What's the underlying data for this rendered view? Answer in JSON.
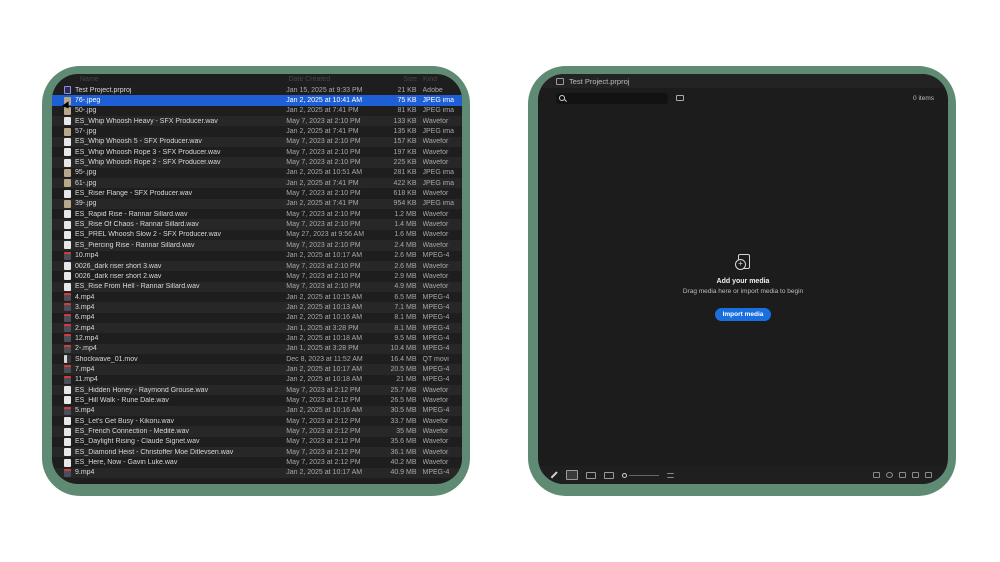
{
  "finder": {
    "header": {
      "name": "Name",
      "date": "Date Created",
      "size": "Size",
      "kind": "Kind"
    },
    "files": [
      {
        "name": "Test Project.prproj",
        "date": "Jan 15, 2025 at 9:33 PM",
        "size": "21 KB",
        "kind": "Adobe",
        "type": "proj"
      },
      {
        "name": "76-.jpeg",
        "date": "Jan 2, 2025 at 10:41 AM",
        "size": "75 KB",
        "kind": "JPEG ima",
        "type": "img",
        "selected": true
      },
      {
        "name": "50-.jpg",
        "date": "Jan 2, 2025 at 7:41 PM",
        "size": "81 KB",
        "kind": "JPEG ima",
        "type": "img"
      },
      {
        "name": "ES_Whip Whoosh Heavy - SFX Producer.wav",
        "date": "May 7, 2023 at 2:10 PM",
        "size": "133 KB",
        "kind": "Wavefor",
        "type": "wav"
      },
      {
        "name": "57-.jpg",
        "date": "Jan 2, 2025 at 7:41 PM",
        "size": "135 KB",
        "kind": "JPEG ima",
        "type": "img"
      },
      {
        "name": "ES_Whip Whoosh 5 - SFX Producer.wav",
        "date": "May 7, 2023 at 2:10 PM",
        "size": "157 KB",
        "kind": "Wavefor",
        "type": "wav"
      },
      {
        "name": "ES_Whip Whoosh Rope 3 - SFX Producer.wav",
        "date": "May 7, 2023 at 2:10 PM",
        "size": "197 KB",
        "kind": "Wavefor",
        "type": "wav"
      },
      {
        "name": "ES_Whip Whoosh Rope 2 - SFX Producer.wav",
        "date": "May 7, 2023 at 2:10 PM",
        "size": "225 KB",
        "kind": "Wavefor",
        "type": "wav"
      },
      {
        "name": "95-.jpg",
        "date": "Jan 2, 2025 at 10:51 AM",
        "size": "281 KB",
        "kind": "JPEG ima",
        "type": "img"
      },
      {
        "name": "61-.jpg",
        "date": "Jan 2, 2025 at 7:41 PM",
        "size": "422 KB",
        "kind": "JPEG ima",
        "type": "img"
      },
      {
        "name": "ES_Riser Flange - SFX Producer.wav",
        "date": "May 7, 2023 at 2:10 PM",
        "size": "618 KB",
        "kind": "Wavefor",
        "type": "wav"
      },
      {
        "name": "39-.jpg",
        "date": "Jan 2, 2025 at 7:41 PM",
        "size": "954 KB",
        "kind": "JPEG ima",
        "type": "img"
      },
      {
        "name": "ES_Rapid Rise - Rannar Sillard.wav",
        "date": "May 7, 2023 at 2:10 PM",
        "size": "1.2 MB",
        "kind": "Wavefor",
        "type": "wav"
      },
      {
        "name": "ES_Rise Of Chaos - Rannar Sillard.wav",
        "date": "May 7, 2023 at 2:10 PM",
        "size": "1.4 MB",
        "kind": "Wavefor",
        "type": "wav"
      },
      {
        "name": "ES_PREL Whoosh Slow 2 - SFX Producer.wav",
        "date": "May 27, 2023 at 9:56 AM",
        "size": "1.6 MB",
        "kind": "Wavefor",
        "type": "wav"
      },
      {
        "name": "ES_Piercing Rise - Rannar Sillard.wav",
        "date": "May 7, 2023 at 2:10 PM",
        "size": "2.4 MB",
        "kind": "Wavefor",
        "type": "wav"
      },
      {
        "name": "10.mp4",
        "date": "Jan 2, 2025 at 10:17 AM",
        "size": "2.6 MB",
        "kind": "MPEG-4",
        "type": "vid"
      },
      {
        "name": "0026_dark riser short 3.wav",
        "date": "May 7, 2023 at 2:10 PM",
        "size": "2.6 MB",
        "kind": "Wavefor",
        "type": "wav"
      },
      {
        "name": "0026_dark riser short 2.wav",
        "date": "May 7, 2023 at 2:10 PM",
        "size": "2.9 MB",
        "kind": "Wavefor",
        "type": "wav"
      },
      {
        "name": "ES_Rise From Hell - Rannar Sillard.wav",
        "date": "May 7, 2023 at 2:10 PM",
        "size": "4.9 MB",
        "kind": "Wavefor",
        "type": "wav"
      },
      {
        "name": "4.mp4",
        "date": "Jan 2, 2025 at 10:15 AM",
        "size": "6.5 MB",
        "kind": "MPEG-4",
        "type": "vid"
      },
      {
        "name": "3.mp4",
        "date": "Jan 2, 2025 at 10:13 AM",
        "size": "7.1 MB",
        "kind": "MPEG-4",
        "type": "vid"
      },
      {
        "name": "6.mp4",
        "date": "Jan 2, 2025 at 10:16 AM",
        "size": "8.1 MB",
        "kind": "MPEG-4",
        "type": "vid"
      },
      {
        "name": "2.mp4",
        "date": "Jan 1, 2025 at 3:28 PM",
        "size": "8.1 MB",
        "kind": "MPEG-4",
        "type": "vid"
      },
      {
        "name": "12.mp4",
        "date": "Jan 2, 2025 at 10:18 AM",
        "size": "9.5 MB",
        "kind": "MPEG-4",
        "type": "vid"
      },
      {
        "name": "2-.mp4",
        "date": "Jan 1, 2025 at 3:28 PM",
        "size": "10.4 MB",
        "kind": "MPEG-4",
        "type": "vid"
      },
      {
        "name": "Shockwave_01.mov",
        "date": "Dec 8, 2023 at 11:52 AM",
        "size": "16.4 MB",
        "kind": "QT movi",
        "type": "qt"
      },
      {
        "name": "7.mp4",
        "date": "Jan 2, 2025 at 10:17 AM",
        "size": "20.5 MB",
        "kind": "MPEG-4",
        "type": "vid"
      },
      {
        "name": "11.mp4",
        "date": "Jan 2, 2025 at 10:18 AM",
        "size": "21 MB",
        "kind": "MPEG-4",
        "type": "vid"
      },
      {
        "name": "ES_Hidden Honey - Raymond Grouse.wav",
        "date": "May 7, 2023 at 2:12 PM",
        "size": "25.7 MB",
        "kind": "Wavefor",
        "type": "wav"
      },
      {
        "name": "ES_Hill Walk - Rune Dale.wav",
        "date": "May 7, 2023 at 2:12 PM",
        "size": "26.5 MB",
        "kind": "Wavefor",
        "type": "wav"
      },
      {
        "name": "5.mp4",
        "date": "Jan 2, 2025 at 10:16 AM",
        "size": "30.5 MB",
        "kind": "MPEG-4",
        "type": "vid"
      },
      {
        "name": "ES_Let's Get Busy - Kikoru.wav",
        "date": "May 7, 2023 at 2:12 PM",
        "size": "33.7 MB",
        "kind": "Wavefor",
        "type": "wav"
      },
      {
        "name": "ES_French Connection - Medité.wav",
        "date": "May 7, 2023 at 2:12 PM",
        "size": "35 MB",
        "kind": "Wavefor",
        "type": "wav"
      },
      {
        "name": "ES_Daylight Rising - Claude Signet.wav",
        "date": "May 7, 2023 at 2:12 PM",
        "size": "35.6 MB",
        "kind": "Wavefor",
        "type": "wav"
      },
      {
        "name": "ES_Diamond Heist - Christoffer Moe Ditlevsen.wav",
        "date": "May 7, 2023 at 2:12 PM",
        "size": "36.1 MB",
        "kind": "Wavefor",
        "type": "wav"
      },
      {
        "name": "ES_Here, Now - Gavin Luke.wav",
        "date": "May 7, 2023 at 2:12 PM",
        "size": "40.2 MB",
        "kind": "Wavefor",
        "type": "wav"
      },
      {
        "name": "9.mp4",
        "date": "Jan 2, 2025 at 10:17 AM",
        "size": "40.9 MB",
        "kind": "MPEG-4",
        "type": "vid"
      }
    ]
  },
  "project_panel": {
    "title": "Test Project.prproj",
    "item_count": "0 items",
    "empty_title": "Add your media",
    "empty_subtitle": "Drag media here or import media to begin",
    "import_label": "Import media"
  },
  "icons": {
    "search": "search-icon",
    "bin": "new-bin-icon",
    "add_media": "add-media-icon",
    "pencil": "pencil-icon"
  },
  "colors": {
    "frame": "#5f8a73",
    "selection": "#1f5fd6",
    "accent_button": "#1a6fe0"
  }
}
